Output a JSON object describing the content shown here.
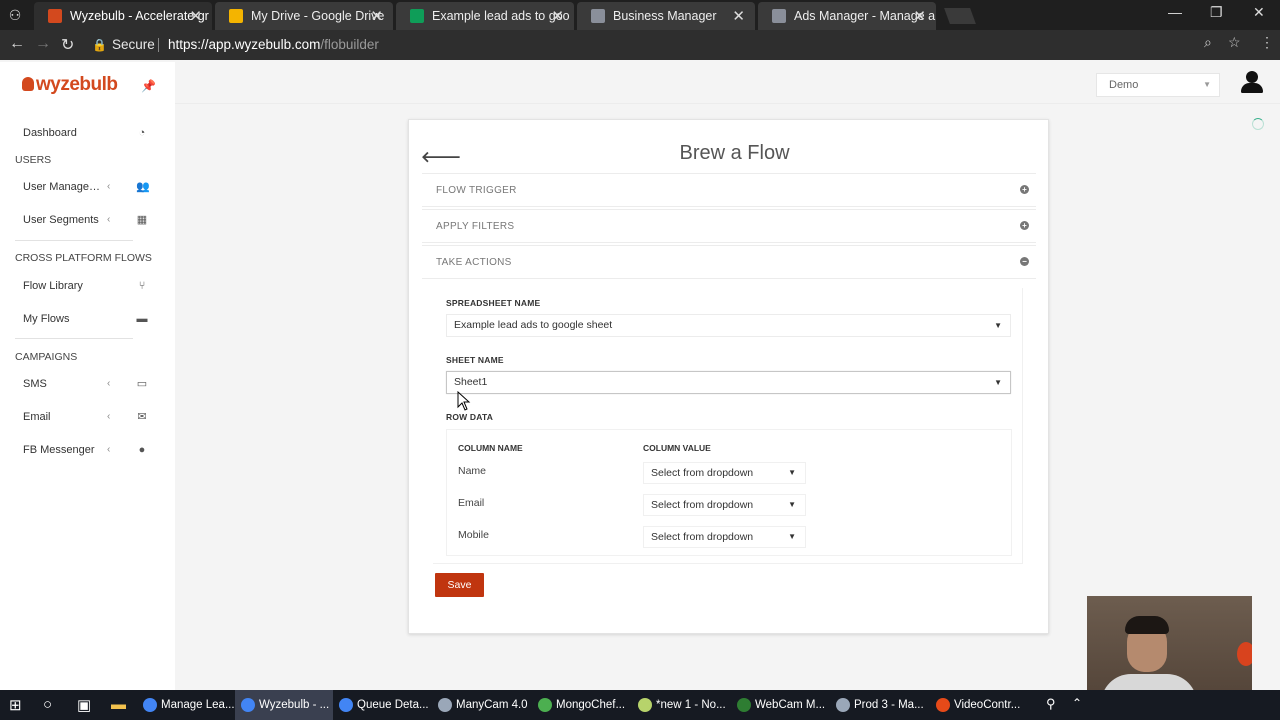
{
  "browser": {
    "tabs": [
      {
        "title": "Wyzebulb - Accelerate gr",
        "favicon_color": "#d3491e",
        "active": true
      },
      {
        "title": "My Drive - Google Drive",
        "favicon_color": "#f4b400",
        "active": false
      },
      {
        "title": "Example lead ads to goo",
        "favicon_color": "#0f9d58",
        "active": false
      },
      {
        "title": "Business Manager",
        "favicon_color": "#8a8f9a",
        "active": false
      },
      {
        "title": "Ads Manager - Manage a",
        "favicon_color": "#8a8f9a",
        "active": false
      }
    ],
    "secure_label": "Secure",
    "url_base": "https://app.wyzebulb.com",
    "url_path": "/flobuilder"
  },
  "sidebar": {
    "logo_text": "wyzebulb",
    "items": {
      "dashboard": "Dashboard",
      "users_heading": "USERS",
      "user_management": "User Managem...",
      "user_segments": "User Segments",
      "cross_heading": "CROSS PLATFORM FLOWS",
      "flow_library": "Flow Library",
      "my_flows": "My Flows",
      "campaigns_heading": "CAMPAIGNS",
      "sms": "SMS",
      "email": "Email",
      "fb_messenger": "FB Messenger"
    }
  },
  "topbar": {
    "account_select": "Demo"
  },
  "flow": {
    "title": "Brew a Flow",
    "sections": {
      "trigger": "FLOW TRIGGER",
      "filters": "APPLY FILTERS",
      "actions": "TAKE ACTIONS"
    },
    "spreadsheet_label": "SPREADSHEET NAME",
    "spreadsheet_value": "Example lead ads to google sheet",
    "sheet_label": "SHEET NAME",
    "sheet_value": "Sheet1",
    "row_data_label": "ROW DATA",
    "column_name_header": "COLUMN NAME",
    "column_value_header": "COLUMN VALUE",
    "rows": [
      {
        "name": "Name",
        "value": "Select from dropdown"
      },
      {
        "name": "Email",
        "value": "Select from dropdown"
      },
      {
        "name": "Mobile",
        "value": "Select from dropdown"
      }
    ],
    "save_label": "Save"
  },
  "taskbar": {
    "tasks": [
      {
        "label": "Manage Lea...",
        "icon_color": "#4285f4"
      },
      {
        "label": "Wyzebulb - ...",
        "icon_color": "#4285f4"
      },
      {
        "label": "Queue Deta...",
        "icon_color": "#4285f4"
      },
      {
        "label": "ManyCam 4.0",
        "icon_color": "#9aa7b8"
      },
      {
        "label": "MongoChef...",
        "icon_color": "#4caf50"
      },
      {
        "label": "*new 1 - No...",
        "icon_color": "#b7d36b"
      },
      {
        "label": "WebCam M...",
        "icon_color": "#2e7d32"
      },
      {
        "label": "Prod 3 - Ma...",
        "icon_color": "#9aa7b8"
      },
      {
        "label": "VideoContr...",
        "icon_color": "#e64a19"
      }
    ]
  },
  "colors": {
    "accent": "#c0350f",
    "brand": "#d3491e"
  }
}
